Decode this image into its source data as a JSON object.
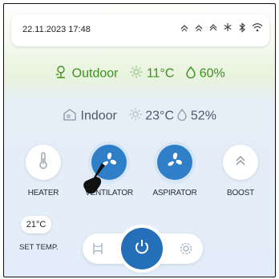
{
  "status_bar": {
    "datetime": "22.11.2023 17:48",
    "icons": [
      "ventilator-status-icon",
      "aspirator-status-icon",
      "boost-status-icon",
      "snowflake-icon",
      "bluetooth-icon",
      "wifi-icon"
    ]
  },
  "outdoor": {
    "label": "Outdoor",
    "temperature": "11°C",
    "humidity": "60%"
  },
  "indoor": {
    "label": "Indoor",
    "temperature": "23°C",
    "humidity": "52%"
  },
  "modes": [
    {
      "label": "HEATER",
      "active": false,
      "icon": "thermometer-icon"
    },
    {
      "label": "VENTILATOR",
      "active": true,
      "icon": "fan-icon"
    },
    {
      "label": "ASPIRATOR",
      "active": true,
      "icon": "fan-icon"
    },
    {
      "label": "BOOST",
      "active": false,
      "icon": "double-chevron-up-icon"
    }
  ],
  "set_temp": {
    "value": "21°C",
    "label": "SET TEMP."
  },
  "controls": {
    "left_icon": "schedule-icon",
    "center_icon": "power-icon",
    "right_icon": "settings-gear-icon"
  },
  "colors": {
    "accent": "#2f7fc8",
    "outdoor_green": "#3e8f22"
  }
}
